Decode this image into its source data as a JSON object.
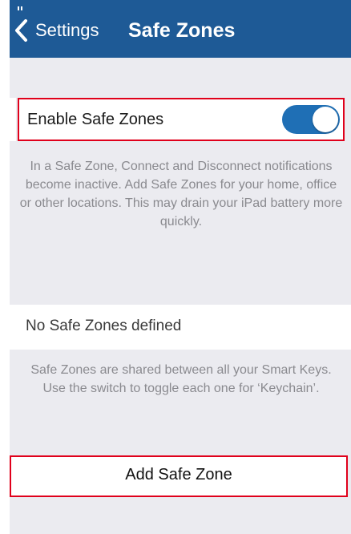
{
  "nav": {
    "back_label": "Settings",
    "title": "Safe Zones"
  },
  "enable_row": {
    "label": "Enable Safe Zones",
    "toggle_on": true
  },
  "description_1": "In a Safe Zone, Connect and Disconnect notifications become inactive. Add Safe Zones for your home, office or other locations. This may drain your iPad battery more quickly.",
  "no_zones_label": "No Safe Zones defined",
  "description_2": "Safe Zones are shared between all your Smart Keys. Use the switch to toggle each one for ‘Keychain’.",
  "add_button_label": "Add Safe Zone",
  "colors": {
    "nav_bar": "#1e5a96",
    "toggle_on": "#1f6fb5",
    "highlight_border": "#e0001b",
    "background": "#ebebf0"
  },
  "icons": {
    "back": "chevron-left-icon"
  }
}
